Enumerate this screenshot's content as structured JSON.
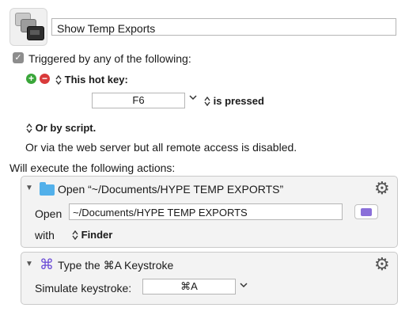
{
  "macro": {
    "name": "Show Temp Exports"
  },
  "trigger": {
    "checkbox_mark": "✓",
    "label": "Triggered by any of the following:",
    "hotkey_label": "This hot key:",
    "hotkey_value": "F6",
    "hotkey_condition": "is pressed",
    "script_label": "Or by script.",
    "web_server_text": "Or via the web server but all remote access is disabled."
  },
  "actions_header": "Will execute the following actions:",
  "actions": [
    {
      "title": "Open “~/Documents/HYPE TEMP EXPORTS”",
      "open_label": "Open",
      "path": "~/Documents/HYPE TEMP EXPORTS",
      "with_label": "with",
      "app": "Finder"
    },
    {
      "title": "Type the ⌘A Keystroke",
      "simulate_label": "Simulate keystroke:",
      "keystroke": "⌘A"
    }
  ],
  "icons": {
    "add": "+",
    "remove": "−",
    "updown": "⌃⌄",
    "chevron": "⌄",
    "collapse": "▼",
    "gear": "⚙",
    "cmd": "⌘"
  },
  "colors": {
    "add": "#3aa63a",
    "remove": "#d93a3a",
    "folder": "#52b0ea",
    "keystroke_icon": "#6a4bd6"
  }
}
